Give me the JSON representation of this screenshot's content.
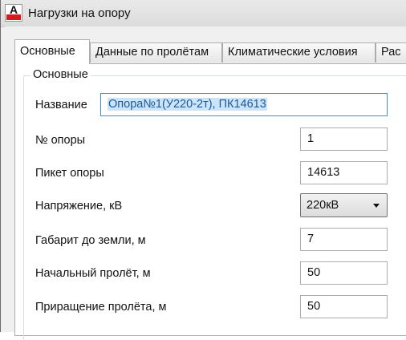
{
  "window": {
    "title": "Нагрузки на опору",
    "icon_letter": "A"
  },
  "tabs": [
    {
      "label": "Основные",
      "active": true
    },
    {
      "label": "Данные по пролётам",
      "active": false
    },
    {
      "label": "Климатические условия",
      "active": false
    },
    {
      "label": "Рас",
      "active": false
    }
  ],
  "group": {
    "title": "Основные"
  },
  "form": {
    "name": {
      "label": "Название",
      "value": "Опора№1(У220-2т), ПК14613"
    },
    "support_no": {
      "label": "№ опоры",
      "value": "1"
    },
    "picket": {
      "label": "Пикет опоры",
      "value": "14613"
    },
    "voltage": {
      "label": "Напряжение, кВ",
      "value": "220кВ"
    },
    "clearance": {
      "label": "Габарит до земли, м",
      "value": "7"
    },
    "initial_span": {
      "label": "Начальный пролёт, м",
      "value": "50"
    },
    "span_increment": {
      "label": "Приращение пролёта, м",
      "value": "50"
    }
  }
}
